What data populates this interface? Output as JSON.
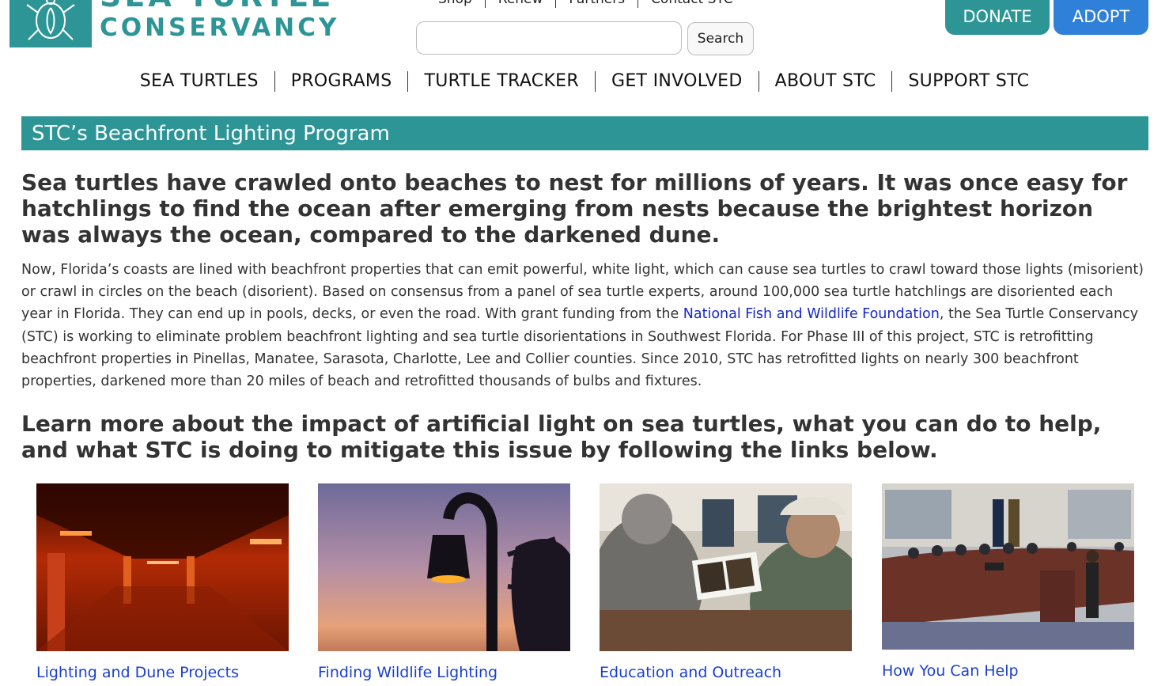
{
  "logo": {
    "line1": "SEA TURTLE",
    "line2": "CONSERVANCY"
  },
  "utility_nav": [
    "Shop",
    "Renew",
    "Partners",
    "Contact STC"
  ],
  "search": {
    "placeholder": "",
    "button_label": "Search"
  },
  "cta": {
    "donate": "DONATE",
    "adopt": "ADOPT"
  },
  "main_nav": [
    "SEA TURTLES",
    "PROGRAMS",
    "TURTLE TRACKER",
    "GET INVOLVED",
    "ABOUT STC",
    "SUPPORT STC"
  ],
  "banner_title": "STC’s Beachfront Lighting Program",
  "lead": "Sea turtles have crawled onto beaches to nest for millions of years. It was once easy for hatchlings to find the ocean after emerging from nests because the brightest horizon was always the ocean, compared to the darkened dune.",
  "body": {
    "before_link": "Now, Florida’s coasts are lined with beachfront properties that can emit powerful, white light, which can cause sea turtles to crawl toward those lights (misorient) or crawl in circles on the beach (disorient). Based on consensus from a panel of sea turtle experts, around 100,000 sea turtle hatchlings are disoriented each year in Florida. They can end up in pools, decks, or even the road. With grant funding from the ",
    "link": "National Fish and Wildlife Foundation",
    "after_link": ", the Sea Turtle Conservancy (STC) is working to eliminate problem beachfront lighting and sea turtle disorientations in Southwest Florida. For Phase III of this project, STC is retrofitting beachfront properties in Pinellas, Manatee, Sarasota, Charlotte, Lee and Collier counties. Since 2010, STC has retrofitted lights on nearly 300 beachfront properties, darkened more than 20 miles of beach and retrofitted thousands of bulbs and fixtures."
  },
  "lead2": "Learn more about the impact of artificial light on sea turtles, what you can do to help, and what STC is doing to mitigate this issue by following the links below.",
  "cards": [
    {
      "label": "Lighting and Dune Projects"
    },
    {
      "label": "Finding Wildlife Lighting"
    },
    {
      "label": "Education and Outreach"
    },
    {
      "label": "How You Can Help"
    }
  ],
  "colors": {
    "teal": "#2e9596",
    "adopt_blue": "#2f80d8",
    "link_blue": "#1526c9"
  }
}
